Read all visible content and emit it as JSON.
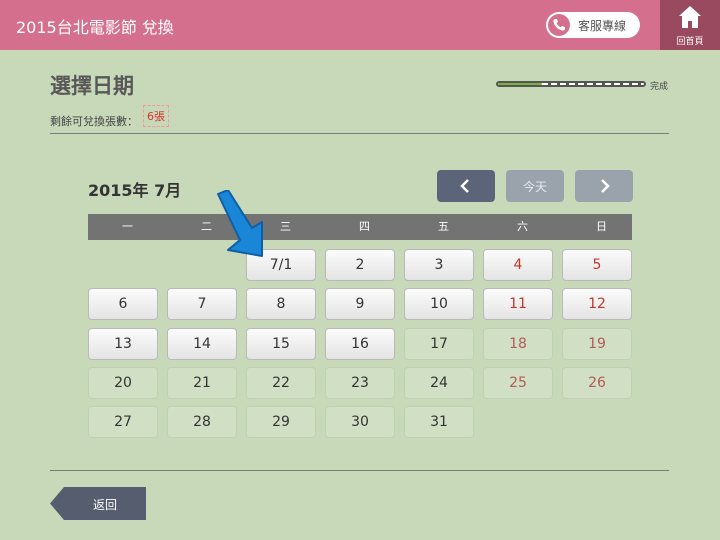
{
  "header": {
    "title": "2015台北電影節 兌換",
    "service_label": "客服專線",
    "home_label": "回首頁"
  },
  "page": {
    "title": "選擇日期",
    "remaining_label": "剩餘可兌換張數：",
    "remaining_value": "6張",
    "progress_label": "完成",
    "progress_fraction": 0.3
  },
  "calendar": {
    "month_label": "2015年 7月",
    "today_label": "今天",
    "weekdays": [
      "一",
      "二",
      "三",
      "四",
      "五",
      "六",
      "日"
    ],
    "days": [
      {
        "label": "7/1",
        "active": true,
        "weekend": false
      },
      {
        "label": "2",
        "active": true,
        "weekend": false
      },
      {
        "label": "3",
        "active": true,
        "weekend": false
      },
      {
        "label": "4",
        "active": true,
        "weekend": true
      },
      {
        "label": "5",
        "active": true,
        "weekend": true
      },
      {
        "label": "6",
        "active": true,
        "weekend": false
      },
      {
        "label": "7",
        "active": true,
        "weekend": false
      },
      {
        "label": "8",
        "active": true,
        "weekend": false
      },
      {
        "label": "9",
        "active": true,
        "weekend": false
      },
      {
        "label": "10",
        "active": true,
        "weekend": false
      },
      {
        "label": "11",
        "active": true,
        "weekend": true
      },
      {
        "label": "12",
        "active": true,
        "weekend": true
      },
      {
        "label": "13",
        "active": true,
        "weekend": false
      },
      {
        "label": "14",
        "active": true,
        "weekend": false
      },
      {
        "label": "15",
        "active": true,
        "weekend": false
      },
      {
        "label": "16",
        "active": true,
        "weekend": false
      },
      {
        "label": "17",
        "active": false,
        "weekend": false
      },
      {
        "label": "18",
        "active": false,
        "weekend": true
      },
      {
        "label": "19",
        "active": false,
        "weekend": true
      },
      {
        "label": "20",
        "active": false,
        "weekend": false
      },
      {
        "label": "21",
        "active": false,
        "weekend": false
      },
      {
        "label": "22",
        "active": false,
        "weekend": false
      },
      {
        "label": "23",
        "active": false,
        "weekend": false
      },
      {
        "label": "24",
        "active": false,
        "weekend": false
      },
      {
        "label": "25",
        "active": false,
        "weekend": true
      },
      {
        "label": "26",
        "active": false,
        "weekend": true
      },
      {
        "label": "27",
        "active": false,
        "weekend": false
      },
      {
        "label": "28",
        "active": false,
        "weekend": false
      },
      {
        "label": "29",
        "active": false,
        "weekend": false
      },
      {
        "label": "30",
        "active": false,
        "weekend": false
      },
      {
        "label": "31",
        "active": false,
        "weekend": false
      }
    ]
  },
  "footer": {
    "back_label": "返回"
  },
  "colors": {
    "header": "#d56f8e",
    "home": "#9a4a5e",
    "background": "#c8d9b9",
    "nav_active": "#5c6479",
    "nav_disabled": "#9aa2ac",
    "weekend": "#c0392b",
    "arrow": "#1a86d8"
  },
  "icons": {
    "phone": "phone-icon",
    "home": "home-icon",
    "prev": "chevron-left-icon",
    "next": "chevron-right-icon",
    "pointer": "pointer-arrow-icon"
  }
}
